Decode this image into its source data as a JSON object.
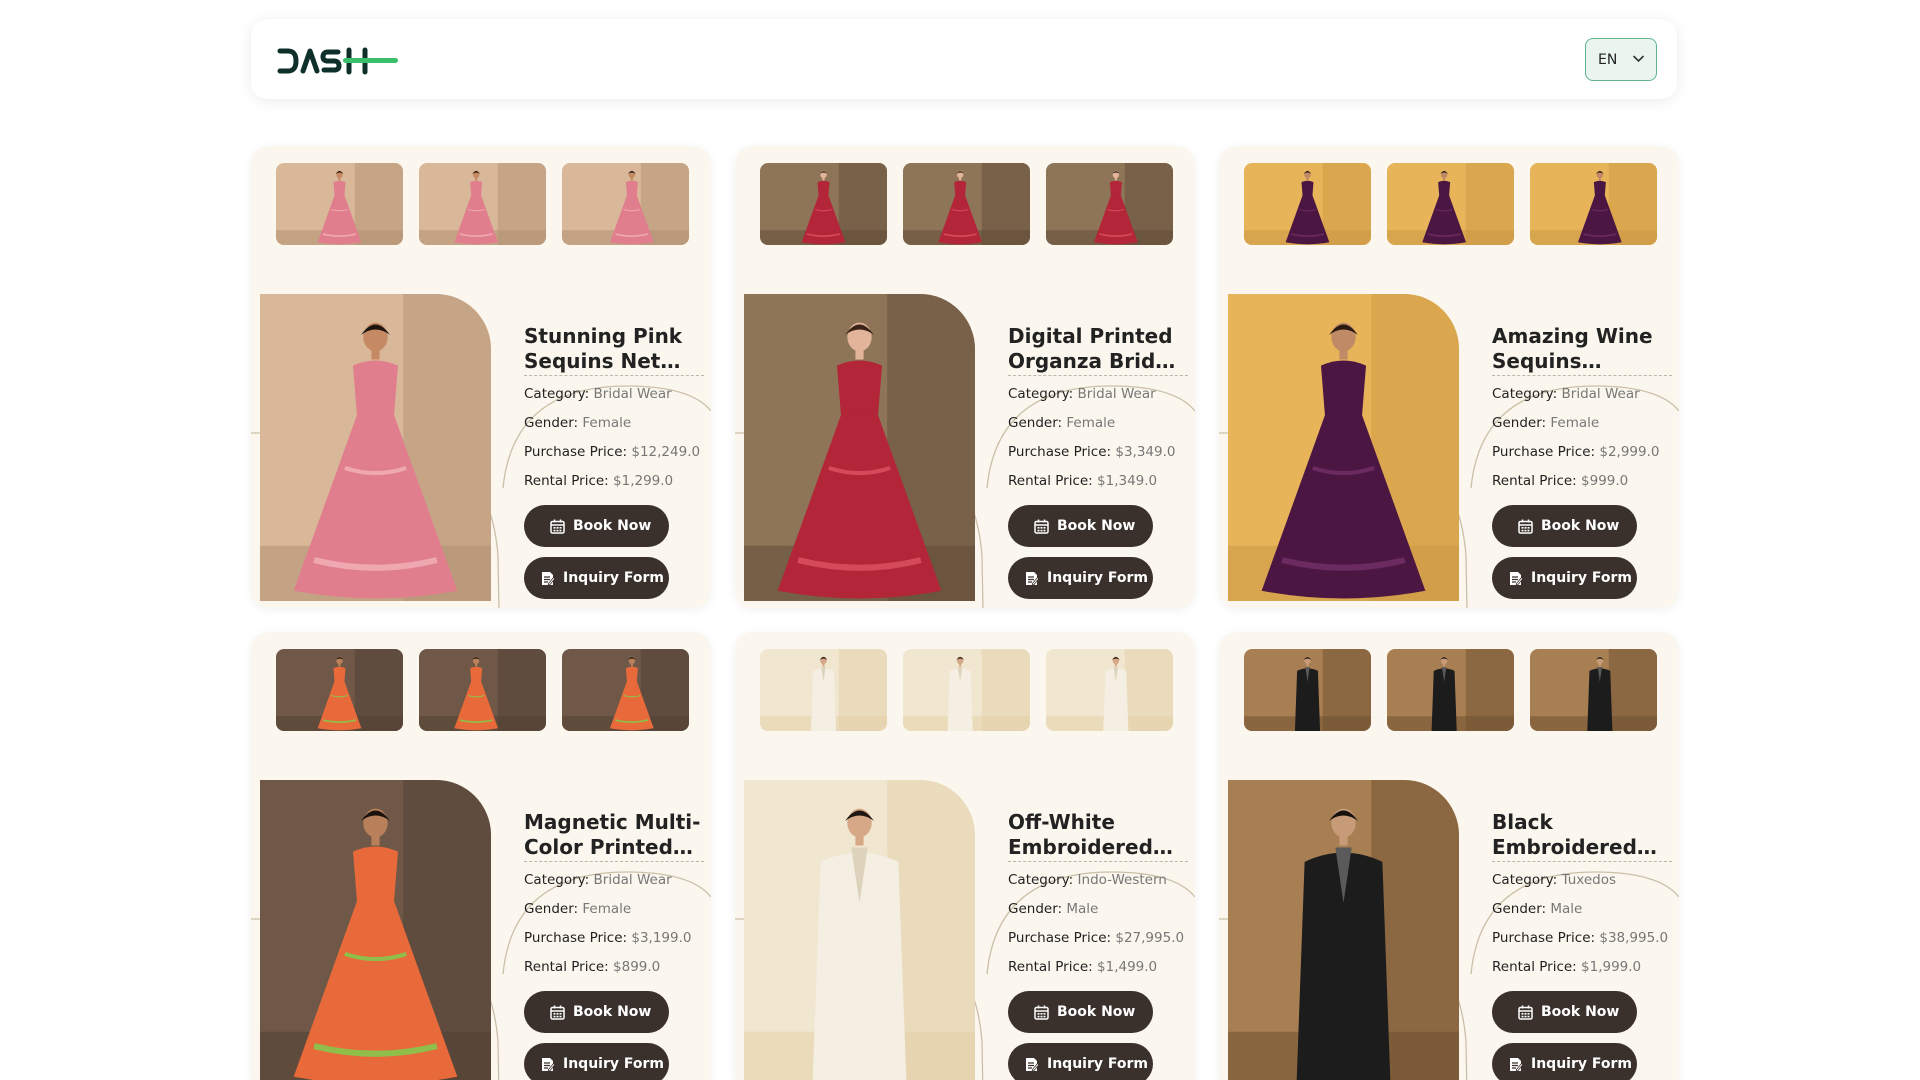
{
  "header": {
    "logo_alt": "DASH",
    "language": "EN"
  },
  "labels": {
    "category": "Category:",
    "gender": "Gender:",
    "purchase": "Purchase Price:",
    "rental": "Rental Price:",
    "book": "Book Now",
    "inquiry": "Inquiry Form"
  },
  "products": [
    {
      "title": "Stunning Pink Sequins Net Bridal Lehenga",
      "category": "Bridal Wear",
      "gender": "Female",
      "purchase": "$12,249.0",
      "rental": "$1,299.0",
      "colors": {
        "bg": "#d9b89a",
        "bg2": "#b08d70",
        "dress": "#e07e8e",
        "dress2": "#f0a8b0",
        "skin": "#c58a63",
        "hair": "#1d1410"
      }
    },
    {
      "title": "Digital Printed Organza Bridal Lehenga",
      "category": "Bridal Wear",
      "gender": "Female",
      "purchase": "$3,349.0",
      "rental": "$1,349.0",
      "colors": {
        "bg": "#8e7558",
        "bg2": "#5e4a36",
        "dress": "#b32538",
        "dress2": "#d44a5a",
        "skin": "#e2b49a",
        "hair": "#3a2418"
      }
    },
    {
      "title": "Amazing Wine Sequins Georgette Wedding Lehenga",
      "category": "Bridal Wear",
      "gender": "Female",
      "purchase": "$2,999.0",
      "rental": "$999.0",
      "colors": {
        "bg": "#e7b45a",
        "bg2": "#c99643",
        "dress": "#4b1642",
        "dress2": "#6b2a60",
        "skin": "#c08a66",
        "hair": "#2a1a12"
      }
    },
    {
      "title": "Magnetic Multi-Color Printed Chinon Draped Set",
      "category": "Bridal Wear",
      "gender": "Female",
      "purchase": "$3,199.0",
      "rental": "$899.0",
      "colors": {
        "bg": "#6f5847",
        "bg2": "#4e3e32",
        "dress": "#e86a3a",
        "dress2": "#8fbf4a",
        "skin": "#b9805c",
        "hair": "#1a120d"
      }
    },
    {
      "title": "Off-White Embroidered Indo-Western Set",
      "category": "Indo-Western",
      "gender": "Male",
      "purchase": "$27,995.0",
      "rental": "$1,499.0",
      "colors": {
        "bg": "#f1e6cf",
        "bg2": "#e3cfa6",
        "dress": "#f4efe2",
        "dress2": "#ddd2bb",
        "skin": "#d6a887",
        "hair": "#1d1612"
      }
    },
    {
      "title": "Black Embroidered Tuxedo Suit",
      "category": "Tuxedos",
      "gender": "Male",
      "purchase": "$38,995.0",
      "rental": "$1,999.0",
      "colors": {
        "bg": "#a87f52",
        "bg2": "#6b4d2e",
        "dress": "#1c1c1c",
        "dress2": "#5a5a5a",
        "skin": "#c79a78",
        "hair": "#17110d"
      }
    }
  ]
}
